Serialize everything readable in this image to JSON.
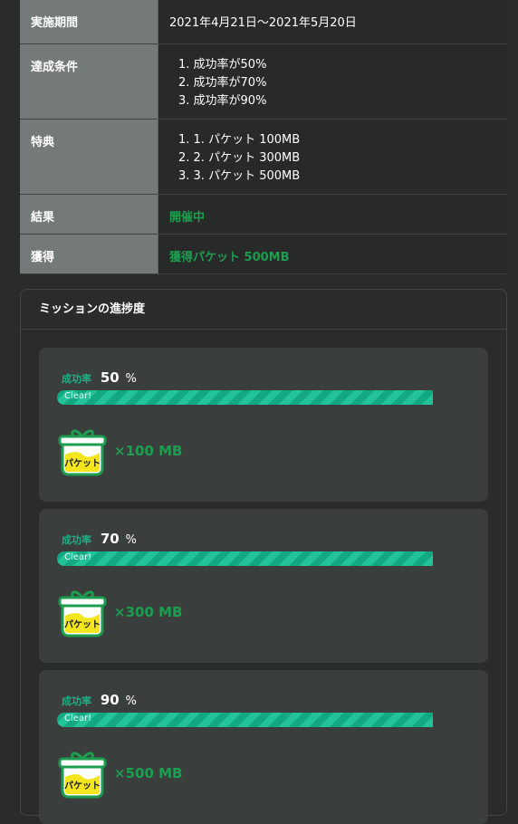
{
  "table": {
    "period": {
      "label": "実施期間",
      "value": "2021年4月21日～2021年5月20日"
    },
    "conditions": {
      "label": "達成条件",
      "items": [
        "1. 成功率が50%",
        "2. 成功率が70%",
        "3. 成功率が90%"
      ]
    },
    "benefits": {
      "label": "特典",
      "items": [
        "1. 1. パケット 100MB",
        "2. 2. パケット 300MB",
        "3. 3. パケット 500MB"
      ]
    },
    "result": {
      "label": "結果",
      "value": "開催中"
    },
    "earned": {
      "label": "獲得",
      "value": "獲得パケット 500MB"
    }
  },
  "progress": {
    "title": "ミッションの進捗度",
    "rate_label": "成功率",
    "unit": "%",
    "missions": [
      {
        "rate": "50",
        "progress_percent": 100,
        "status": "Clear!",
        "reward": "×100 MB",
        "icon_label": "パケット"
      },
      {
        "rate": "70",
        "progress_percent": 100,
        "status": "Clear!",
        "reward": "×300 MB",
        "icon_label": "パケット"
      },
      {
        "rate": "90",
        "progress_percent": 100,
        "status": "Clear!",
        "reward": "×500 MB",
        "icon_label": "パケット"
      }
    ]
  },
  "colors": {
    "accent_green": "#1d9d4f",
    "bar_teal": "#12a882",
    "header_cell": "#747a79",
    "card_bg": "#3a3e3d"
  }
}
